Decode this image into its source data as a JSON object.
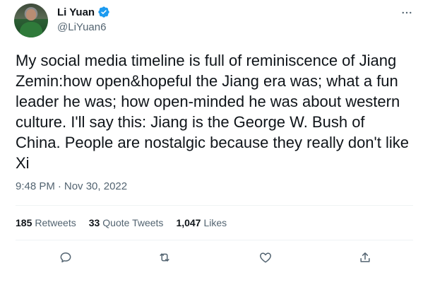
{
  "author": {
    "display_name": "Li Yuan",
    "handle": "@LiYuan6",
    "verified": true
  },
  "icons": {
    "verified": "verified-badge-icon",
    "more": "more-options-icon",
    "reply": "reply-icon",
    "retweet": "retweet-icon",
    "like": "like-icon",
    "share": "share-icon"
  },
  "tweet": {
    "text": "My social media timeline is full of reminiscence of Jiang Zemin:how open&hopeful the Jiang era was; what a fun leader he was; how open-minded he was about western culture. I'll say this: Jiang is the George W. Bush of China. People are nostalgic because they really don't like Xi",
    "time": "9:48 PM",
    "separator": "·",
    "date": "Nov 30, 2022"
  },
  "stats": {
    "retweets_count": "185",
    "retweets_label": "Retweets",
    "quote_count": "33",
    "quote_label": "Quote Tweets",
    "likes_count": "1,047",
    "likes_label": "Likes"
  },
  "colors": {
    "accent": "#1d9bf0",
    "text_primary": "#0f1419",
    "text_secondary": "#536471",
    "divider": "#eff3f4"
  }
}
